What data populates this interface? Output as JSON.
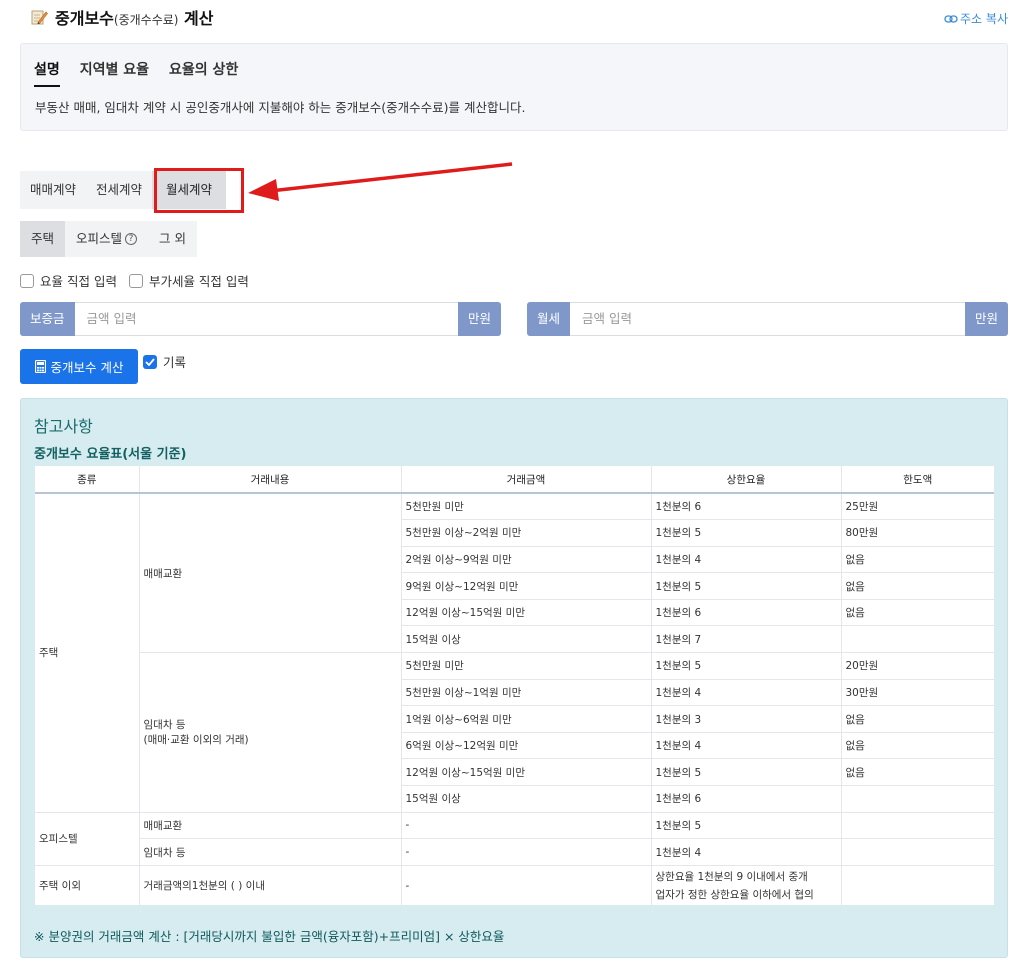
{
  "header": {
    "title": "중개보수",
    "title_paren": "(중개수수료)",
    "title_suffix": "계산",
    "copy_link": "주소 복사"
  },
  "info": {
    "tabs": [
      "설명",
      "지역별 요율",
      "요율의 상한"
    ],
    "description": "부동산 매매, 임대차 계약 시 공인중개사에 지불해야 하는 중개보수(중개수수료)를 계산합니다."
  },
  "contract_tabs": [
    "매매계약",
    "전세계약",
    "월세계약"
  ],
  "property_tabs": [
    "주택",
    "오피스텔",
    "그 외"
  ],
  "checkboxes": [
    "요율 직접 입력",
    "부가세율 직접 입력"
  ],
  "deposit": {
    "label": "보증금",
    "placeholder": "금액 입력",
    "unit": "만원"
  },
  "rent": {
    "label": "월세",
    "placeholder": "금액 입력",
    "unit": "만원"
  },
  "calc_button": "중개보수 계산",
  "record_label": "기록",
  "reference": {
    "title": "참고사항",
    "subtitle": "중개보수 요율표(서울 기준)",
    "headers": [
      "종류",
      "거래내용",
      "거래금액",
      "상한요율",
      "한도액"
    ],
    "groups": {
      "housing": "주택",
      "sale": "매매교환",
      "lease_line1": "임대차 등",
      "lease_line2": "(매매·교환 이외의 거래)",
      "officetel": "오피스텔",
      "officetel_sale": "매매교환",
      "officetel_lease": "임대차 등",
      "other": "주택 이외",
      "other_content": "거래금액의1천분의 ( ) 이내"
    },
    "sale_rows": [
      {
        "amount": "5천만원 미만",
        "rate": "1천분의 6",
        "limit": "25만원"
      },
      {
        "amount": "5천만원 이상~2억원 미만",
        "rate": "1천분의 5",
        "limit": "80만원"
      },
      {
        "amount": "2억원 이상~9억원 미만",
        "rate": "1천분의 4",
        "limit": "없음"
      },
      {
        "amount": "9억원 이상~12억원 미만",
        "rate": "1천분의 5",
        "limit": "없음"
      },
      {
        "amount": "12억원 이상~15억원 미만",
        "rate": "1천분의 6",
        "limit": "없음"
      },
      {
        "amount": "15억원 이상",
        "rate": "1천분의 7",
        "limit": ""
      }
    ],
    "lease_rows": [
      {
        "amount": "5천만원 미만",
        "rate": "1천분의 5",
        "limit": "20만원"
      },
      {
        "amount": "5천만원 이상~1억원 미만",
        "rate": "1천분의 4",
        "limit": "30만원"
      },
      {
        "amount": "1억원 이상~6억원 미만",
        "rate": "1천분의 3",
        "limit": "없음"
      },
      {
        "amount": "6억원 이상~12억원 미만",
        "rate": "1천분의 4",
        "limit": "없음"
      },
      {
        "amount": "12억원 이상~15억원 미만",
        "rate": "1천분의 5",
        "limit": "없음"
      },
      {
        "amount": "15억원 이상",
        "rate": "1천분의 6",
        "limit": ""
      }
    ],
    "officetel_rows": [
      {
        "amount": "-",
        "rate": "1천분의 5"
      },
      {
        "amount": "-",
        "rate": "1천분의 4"
      }
    ],
    "other_row": {
      "amount": "-",
      "rate_line1": "상한요율 1천분의 9 이내에서 중개",
      "rate_line2": "업자가 정한 상한요율 이하에서 협의"
    },
    "note": "※ 분양권의 거래금액 계산 : [거래당시까지 불입한 금액(융자포함)+프리미엄] × 상한요율"
  }
}
